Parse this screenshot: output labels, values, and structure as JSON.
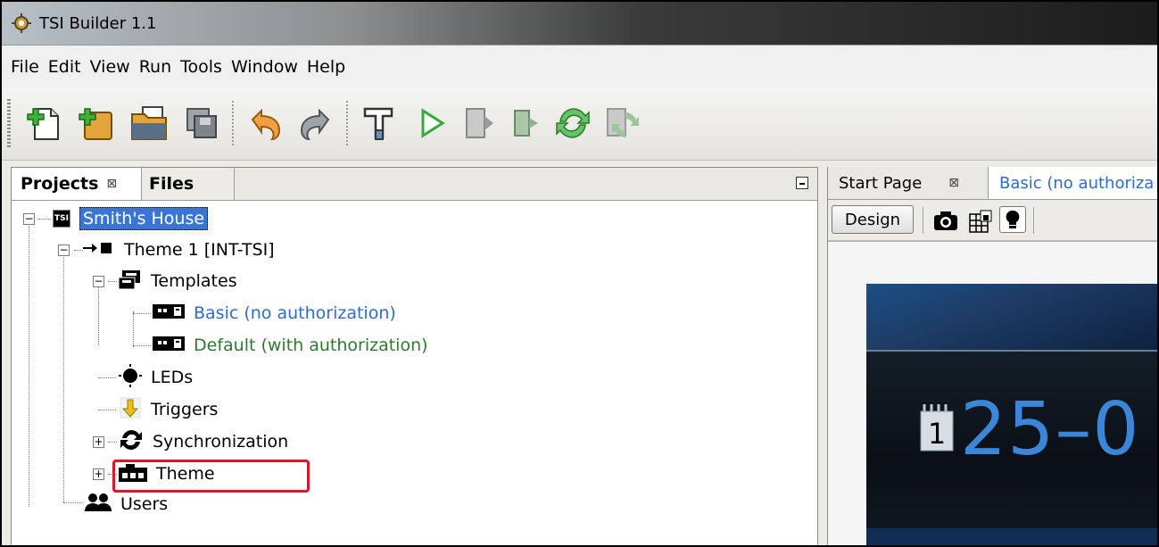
{
  "window": {
    "title": "TSI Builder 1.1"
  },
  "menu": [
    "File",
    "Edit",
    "View",
    "Run",
    "Tools",
    "Window",
    "Help"
  ],
  "toolbar": {
    "icons": [
      "new-file-icon",
      "new-project-icon",
      "open-project-icon",
      "save-all-icon",
      "undo-icon",
      "redo-icon",
      "build-icon",
      "run-icon",
      "stop-icon",
      "sync-icon",
      "sync-disabled-icon"
    ]
  },
  "left_panel": {
    "tabs": {
      "projects": "Projects",
      "projects_close": "⊠",
      "files": "Files"
    },
    "tree": {
      "root": "Smith's House",
      "root_badge": "TSI",
      "theme": "Theme 1 [INT-TSI]",
      "templates": "Templates",
      "template_basic": "Basic (no authorization)",
      "template_default": "Default (with authorization)",
      "leds": "LEDs",
      "triggers": "Triggers",
      "synchronization": "Synchronization",
      "theme_item": "Theme",
      "users": "Users"
    }
  },
  "right_panel": {
    "tabs": {
      "start_page": "Start Page",
      "close": "⊠",
      "basic": "Basic (no authoriza"
    },
    "design_button": "Design",
    "preview": {
      "date": "25–0",
      "calendar_day": "1"
    }
  },
  "colors": {
    "selection": "#3875d7",
    "link_blue": "#2c6cd1",
    "green": "#2c7a2c",
    "highlight": "#e0142a"
  }
}
